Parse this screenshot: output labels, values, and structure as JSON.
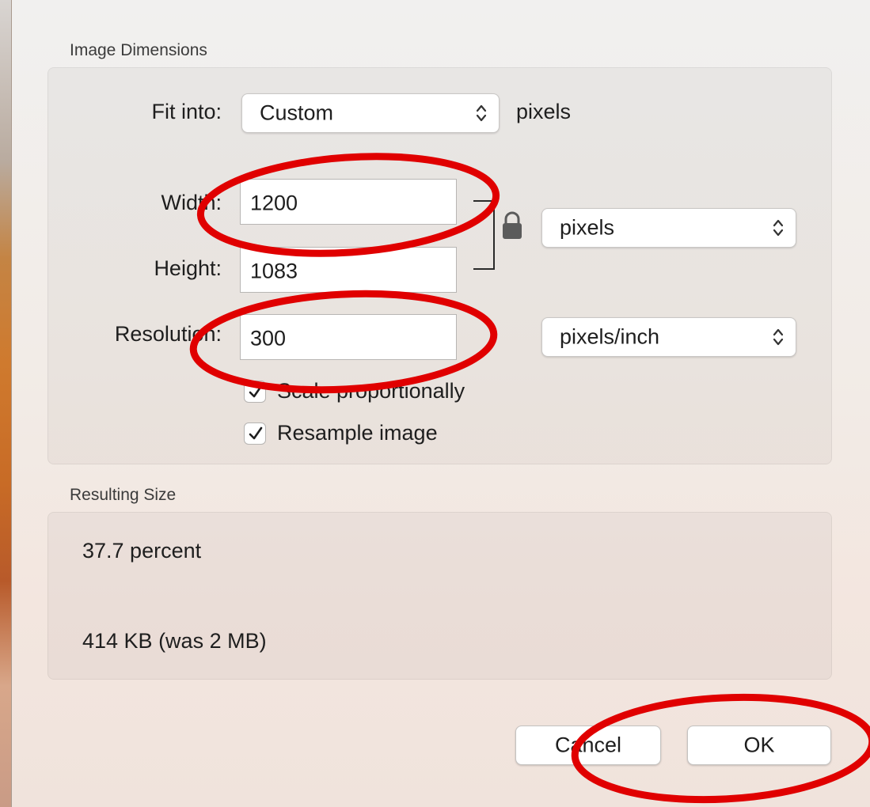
{
  "image_dimensions": {
    "title": "Image Dimensions",
    "fit_into": {
      "label": "Fit into:",
      "selected": "Custom",
      "unit": "pixels"
    },
    "width": {
      "label": "Width:",
      "value": "1200"
    },
    "height": {
      "label": "Height:",
      "value": "1083"
    },
    "size_unit": {
      "selected": "pixels"
    },
    "resolution": {
      "label": "Resolution:",
      "value": "300",
      "unit": "pixels/inch"
    },
    "scale_proportionally": {
      "label": "Scale proportionally",
      "checked": true
    },
    "resample_image": {
      "label": "Resample image",
      "checked": true
    }
  },
  "resulting_size": {
    "title": "Resulting Size",
    "percent": "37.7 percent",
    "file_size": "414 KB (was 2 MB)"
  },
  "buttons": {
    "cancel": "Cancel",
    "ok": "OK"
  },
  "icons": {
    "lock": "lock-icon",
    "updown": "updown-chevron-icon",
    "check": "checkmark-icon"
  },
  "colors": {
    "annotation": "#e00000"
  }
}
